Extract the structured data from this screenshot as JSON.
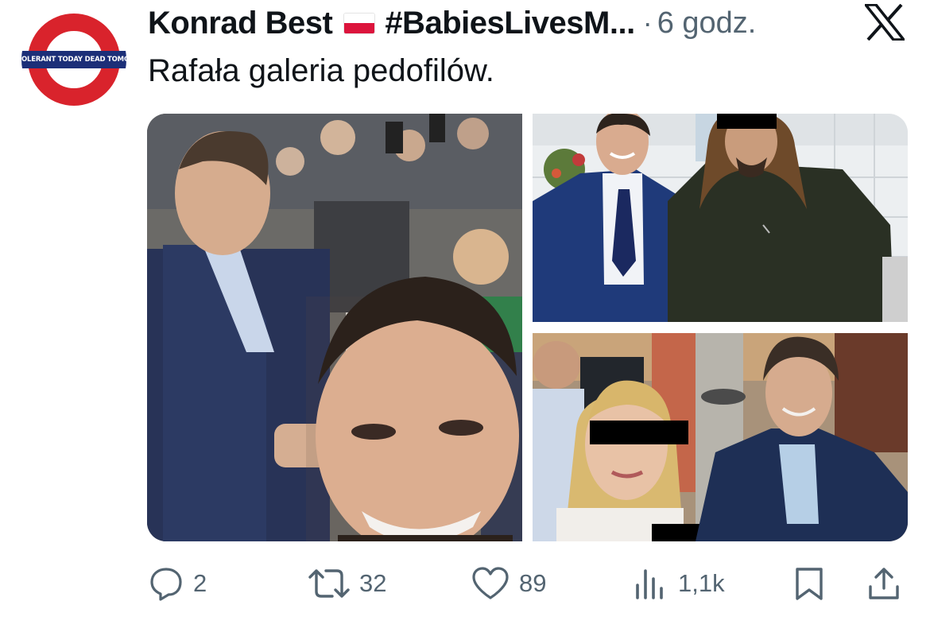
{
  "tweet": {
    "author_name": "Konrad Best",
    "hashtag": "#BabiesLivesM...",
    "separator": "·",
    "time": "6 godz.",
    "text": "Rafała galeria pedofilów.",
    "avatar_text": "OLERANT TODAY DEAD TOMORROW",
    "colors": {
      "text": "#0f1419",
      "secondary": "#536471",
      "avatar_red": "#d9232c",
      "avatar_navy": "#1c2f78"
    }
  },
  "actions": {
    "reply": {
      "icon": "reply-icon",
      "count": "2"
    },
    "retweet": {
      "icon": "retweet-icon",
      "count": "32"
    },
    "like": {
      "icon": "heart-icon",
      "count": "89"
    },
    "views": {
      "icon": "views-icon",
      "count": "1,1k"
    },
    "bookmark": {
      "icon": "bookmark-icon"
    },
    "share": {
      "icon": "share-icon"
    }
  }
}
